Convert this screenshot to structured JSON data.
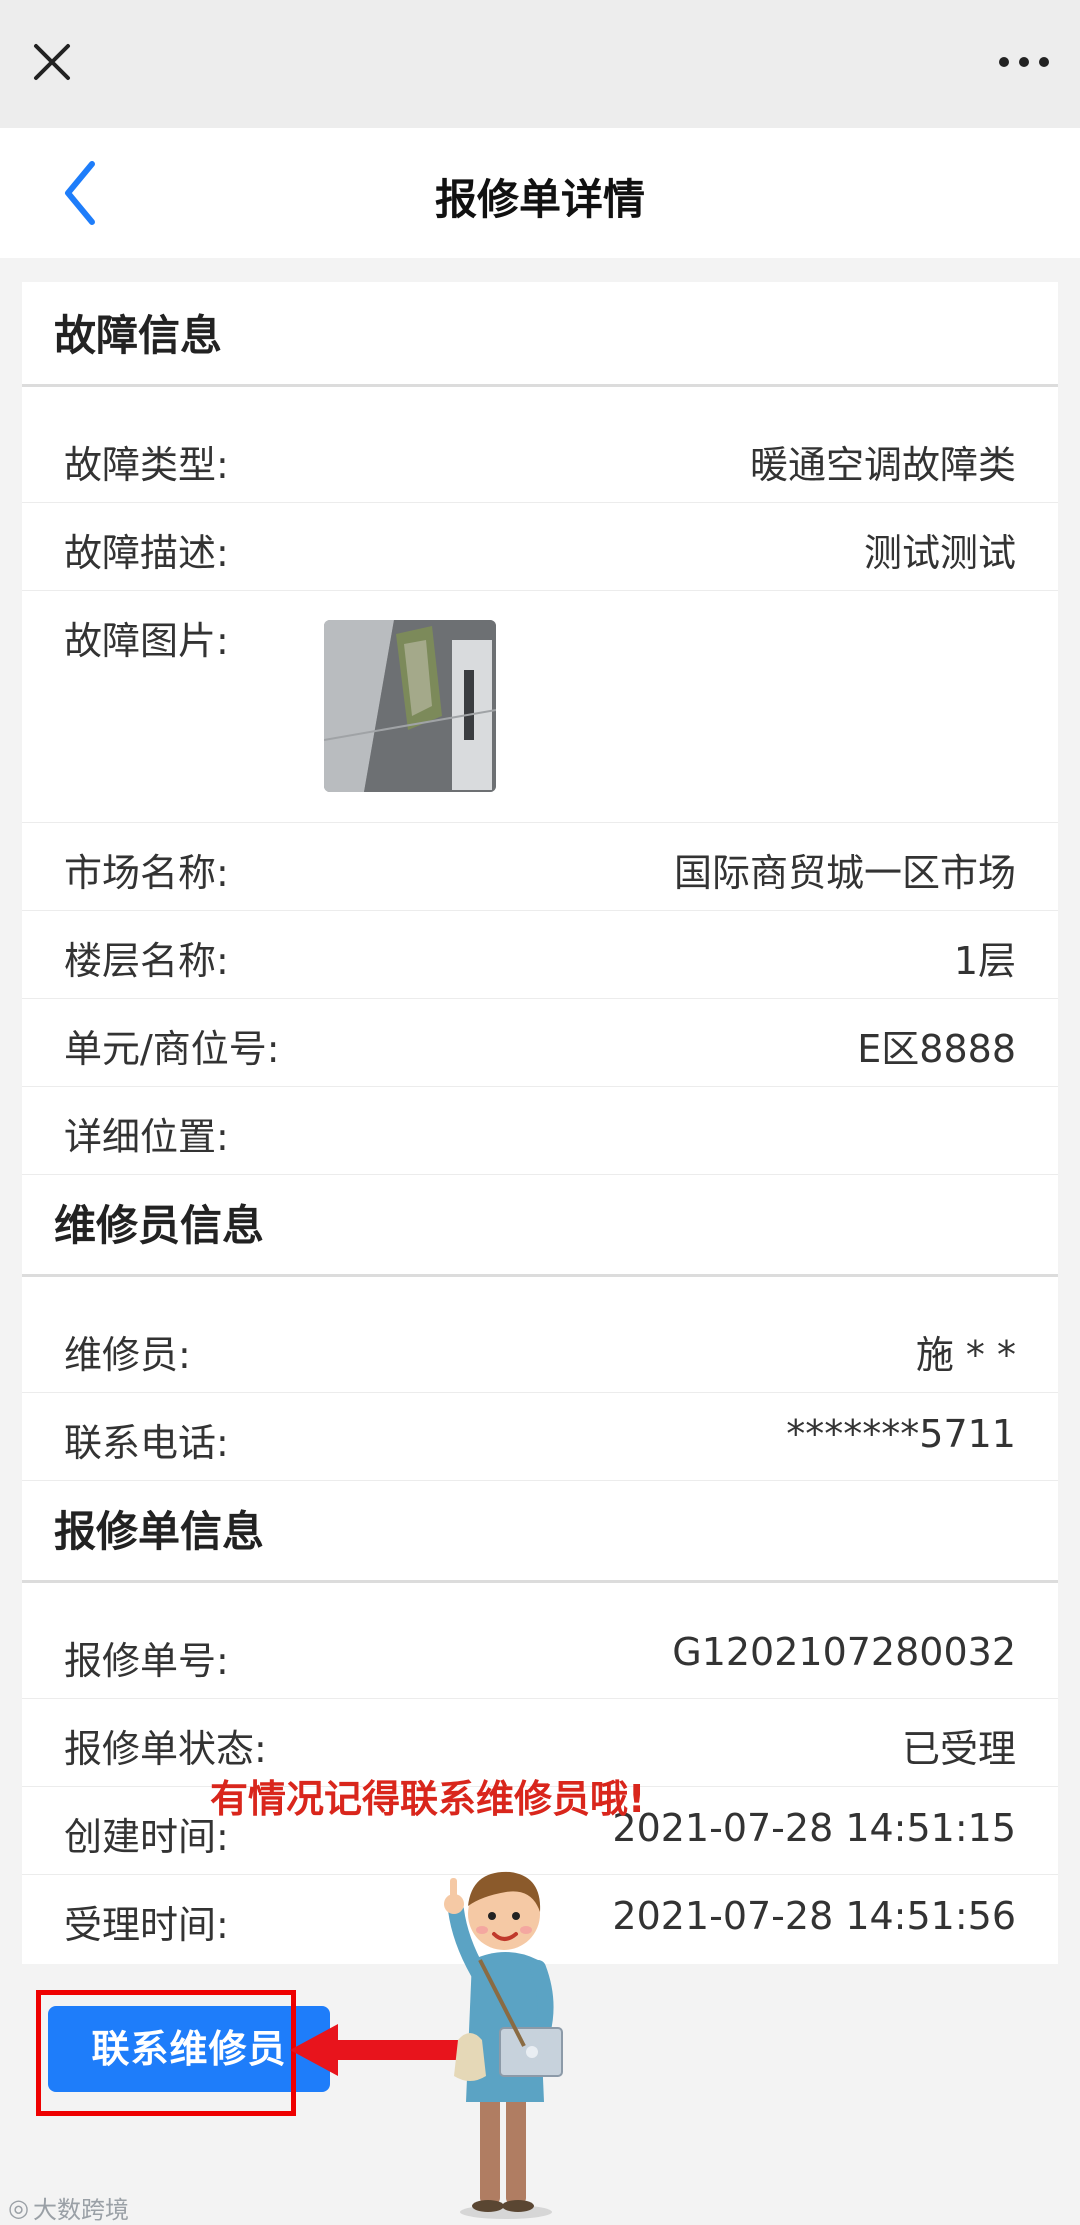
{
  "window": {
    "close_icon": "close-icon",
    "more_icon": "more-icon"
  },
  "header": {
    "title": "报修单详情",
    "back_icon": "chevron-left-icon"
  },
  "fault": {
    "section_title": "故障信息",
    "rows": [
      {
        "label": "故障类型:",
        "value": "暖通空调故障类"
      },
      {
        "label": "故障描述:",
        "value": "测试测试"
      },
      {
        "label": "故障图片:",
        "value": ""
      },
      {
        "label": "市场名称:",
        "value": "国际商贸城一区市场"
      },
      {
        "label": "楼层名称:",
        "value": "1层"
      },
      {
        "label": "单元/商位号:",
        "value": "E区8888"
      },
      {
        "label": "详细位置:",
        "value": ""
      }
    ]
  },
  "repairer": {
    "section_title": "维修员信息",
    "rows": [
      {
        "label": "维修员:",
        "value": "施 * *"
      },
      {
        "label": "联系电话:",
        "value": "*******5711"
      }
    ]
  },
  "order": {
    "section_title": "报修单信息",
    "rows": [
      {
        "label": "报修单号:",
        "value": "G1202107280032"
      },
      {
        "label": "报修单状态:",
        "value": "已受理"
      },
      {
        "label": "创建时间:",
        "value": "2021-07-28 14:51:15"
      },
      {
        "label": "受理时间:",
        "value": "2021-07-28 14:51:56"
      }
    ]
  },
  "actions": {
    "contact_label": "联系维修员"
  },
  "annotation": {
    "tip_text": "有情况记得联系维修员哦!"
  },
  "watermark": {
    "text": "大数跨境"
  },
  "colors": {
    "accent": "#1e7dfa",
    "annotation_red": "#d9261c"
  }
}
